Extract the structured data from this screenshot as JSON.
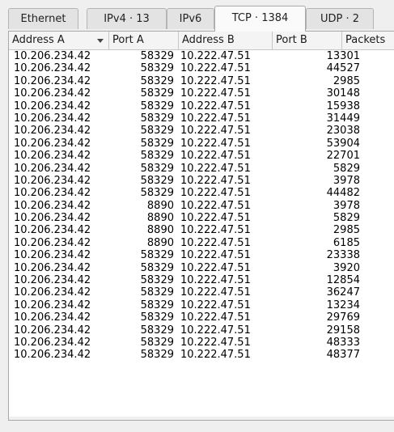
{
  "tabs": [
    {
      "label": "Ethernet",
      "active": false
    },
    {
      "label": "IPv4 · 13",
      "active": false
    },
    {
      "label": "IPv6",
      "active": false
    },
    {
      "label": "TCP · 1384",
      "active": true
    },
    {
      "label": "UDP · 2",
      "active": false
    }
  ],
  "columns": [
    "Address A",
    "Port A",
    "Address B",
    "Port B",
    "Packets"
  ],
  "rows": [
    [
      "10.206.234.42",
      "58329",
      "10.222.47.51",
      "13301"
    ],
    [
      "10.206.234.42",
      "58329",
      "10.222.47.51",
      "44527"
    ],
    [
      "10.206.234.42",
      "58329",
      "10.222.47.51",
      "2985"
    ],
    [
      "10.206.234.42",
      "58329",
      "10.222.47.51",
      "30148"
    ],
    [
      "10.206.234.42",
      "58329",
      "10.222.47.51",
      "15938"
    ],
    [
      "10.206.234.42",
      "58329",
      "10.222.47.51",
      "31449"
    ],
    [
      "10.206.234.42",
      "58329",
      "10.222.47.51",
      "23038"
    ],
    [
      "10.206.234.42",
      "58329",
      "10.222.47.51",
      "53904"
    ],
    [
      "10.206.234.42",
      "58329",
      "10.222.47.51",
      "22701"
    ],
    [
      "10.206.234.42",
      "58329",
      "10.222.47.51",
      "5829"
    ],
    [
      "10.206.234.42",
      "58329",
      "10.222.47.51",
      "3978"
    ],
    [
      "10.206.234.42",
      "58329",
      "10.222.47.51",
      "44482"
    ],
    [
      "10.206.234.42",
      "8890",
      "10.222.47.51",
      "3978"
    ],
    [
      "10.206.234.42",
      "8890",
      "10.222.47.51",
      "5829"
    ],
    [
      "10.206.234.42",
      "8890",
      "10.222.47.51",
      "2985"
    ],
    [
      "10.206.234.42",
      "8890",
      "10.222.47.51",
      "6185"
    ],
    [
      "10.206.234.42",
      "58329",
      "10.222.47.51",
      "23338"
    ],
    [
      "10.206.234.42",
      "58329",
      "10.222.47.51",
      "3920"
    ],
    [
      "10.206.234.42",
      "58329",
      "10.222.47.51",
      "12854"
    ],
    [
      "10.206.234.42",
      "58329",
      "10.222.47.51",
      "36247"
    ],
    [
      "10.206.234.42",
      "58329",
      "10.222.47.51",
      "13234"
    ],
    [
      "10.206.234.42",
      "58329",
      "10.222.47.51",
      "29769"
    ],
    [
      "10.206.234.42",
      "58329",
      "10.222.47.51",
      "29158"
    ],
    [
      "10.206.234.42",
      "58329",
      "10.222.47.51",
      "48333"
    ],
    [
      "10.206.234.42",
      "58329",
      "10.222.47.51",
      "48377"
    ]
  ],
  "sort_icon": "chevron-down-icon"
}
